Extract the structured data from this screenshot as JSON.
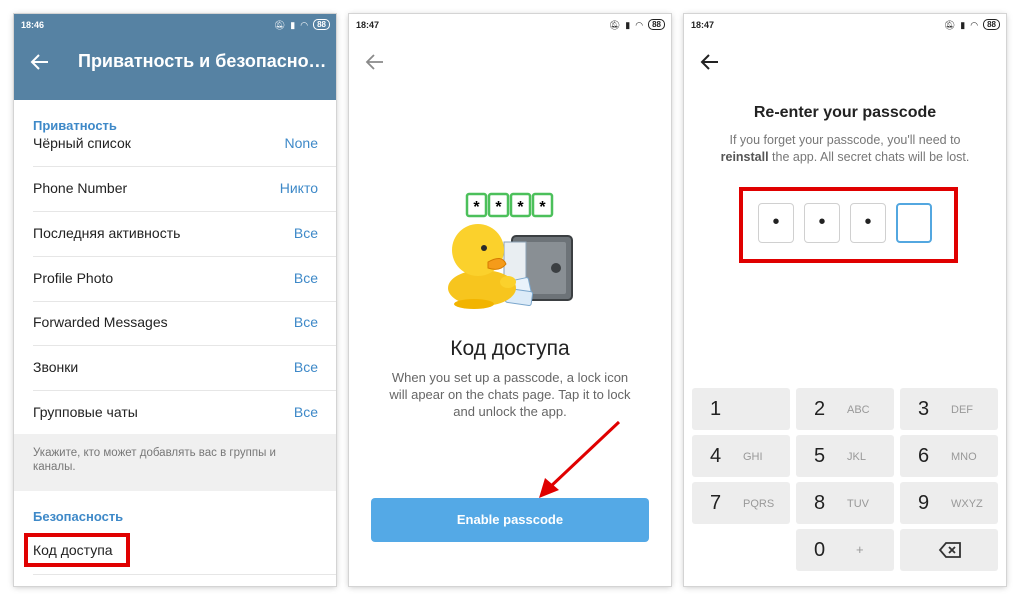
{
  "screen1": {
    "status": {
      "time": "18:46",
      "battery": "88"
    },
    "title": "Приватность и безопасность",
    "privacy_header": "Приватность",
    "rows": [
      {
        "label": "Чёрный список",
        "value": "None"
      },
      {
        "label": "Phone Number",
        "value": "Никто"
      },
      {
        "label": "Последняя активность",
        "value": "Все"
      },
      {
        "label": "Profile Photo",
        "value": "Все"
      },
      {
        "label": "Forwarded Messages",
        "value": "Все"
      },
      {
        "label": "Звонки",
        "value": "Все"
      },
      {
        "label": "Групповые чаты",
        "value": "Все"
      }
    ],
    "groups_hint": "Укажите, кто может добавлять вас в группы и каналы.",
    "security_header": "Безопасность",
    "passcode_item": "Код доступа"
  },
  "screen2": {
    "status": {
      "time": "18:47",
      "battery": "88"
    },
    "sticker_pin": [
      "*",
      "*",
      "*",
      "*"
    ],
    "title": "Код доступа",
    "description": "When you set up a passcode, a lock icon will apear on the chats page. Tap it to lock and unlock the app.",
    "enable_button": "Enable passcode"
  },
  "screen3": {
    "status": {
      "time": "18:47",
      "battery": "88"
    },
    "title": "Re-enter your passcode",
    "desc_part1": "If you forget your passcode, you'll need to",
    "desc_bold": "reinstall",
    "desc_part2": "the app. All secret chats will be lost.",
    "pin": [
      "•",
      "•",
      "•",
      ""
    ],
    "keys": [
      {
        "num": "1",
        "letters": ""
      },
      {
        "num": "2",
        "letters": "ABC"
      },
      {
        "num": "3",
        "letters": "DEF"
      },
      {
        "num": "4",
        "letters": "GHI"
      },
      {
        "num": "5",
        "letters": "JKL"
      },
      {
        "num": "6",
        "letters": "MNO"
      },
      {
        "num": "7",
        "letters": "PQRS"
      },
      {
        "num": "8",
        "letters": "TUV"
      },
      {
        "num": "9",
        "letters": "WXYZ"
      },
      {
        "num": "0",
        "letters": "+"
      }
    ]
  },
  "colors": {
    "header_blue": "#5682a3",
    "accent_blue": "#3e89c8",
    "button_blue": "#54a9e6",
    "highlight_red": "#e00000"
  }
}
